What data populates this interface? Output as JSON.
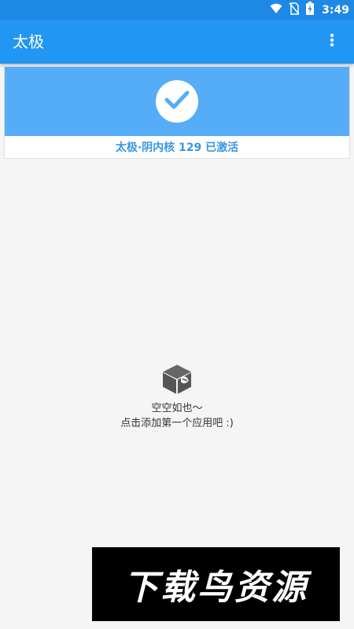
{
  "status_bar": {
    "time": "3:49",
    "icons": [
      "wifi-icon",
      "no-sim-icon",
      "battery-charging-icon"
    ]
  },
  "app_bar": {
    "title": "太极",
    "menu_icon": "more-vert-icon"
  },
  "status_card": {
    "icon": "check-icon",
    "text": "太极·阴内核 129 已激活",
    "accent_color": "#56adf7",
    "text_color": "#3a97df"
  },
  "empty_state": {
    "icon": "empty-box-icon",
    "line1": "空空如也～",
    "line2": "点击添加第一个应用吧 :)"
  },
  "watermark": {
    "text": "下载鸟资源"
  },
  "colors": {
    "primary": "#2196f3",
    "status_bar": "#1e88e5",
    "background": "#f5f5f5"
  }
}
